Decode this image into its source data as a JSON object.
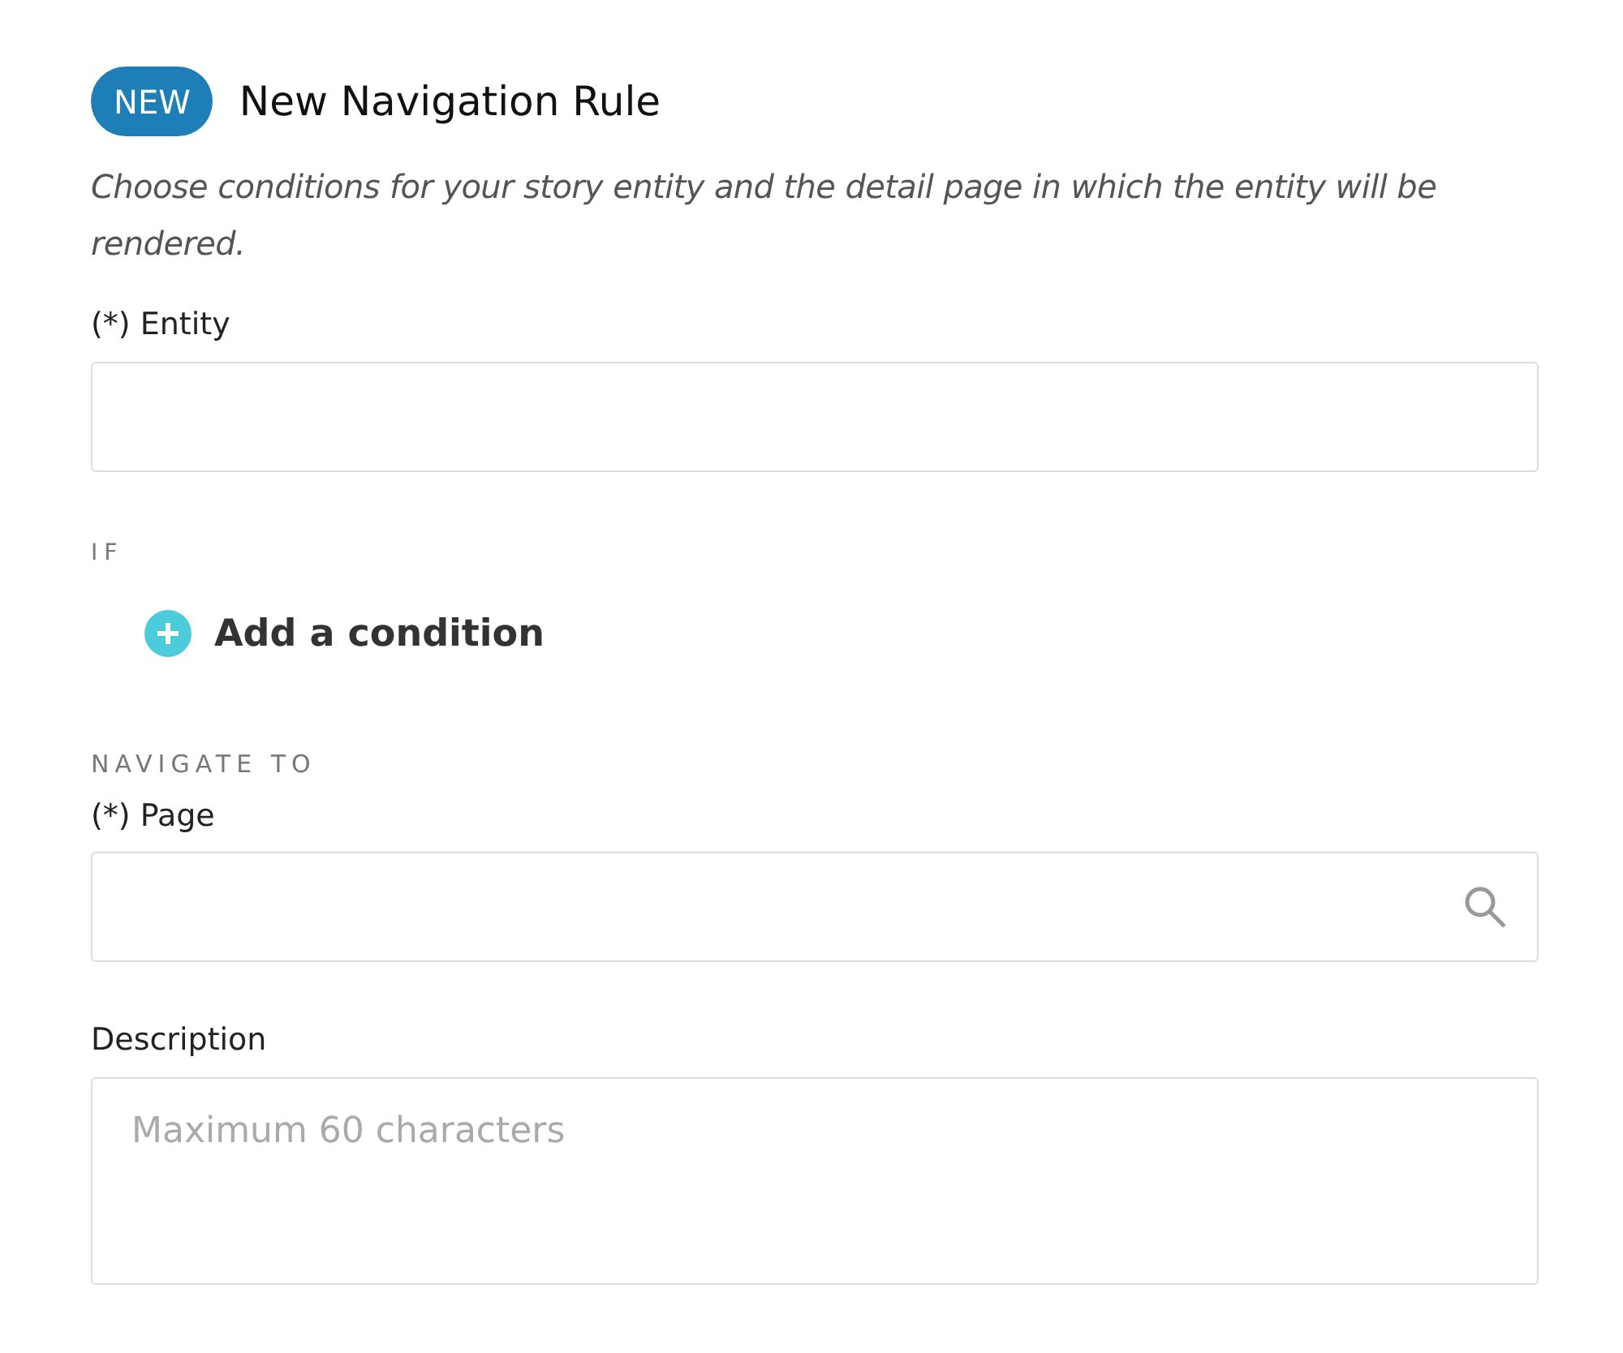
{
  "header": {
    "badge": "NEW",
    "title": "New Navigation Rule"
  },
  "intro": "Choose conditions for your story entity and the detail page in which the entity will be rendered.",
  "entity_field": {
    "label": "(*) Entity"
  },
  "if_section": {
    "heading": "IF",
    "add_button": "Add a condition"
  },
  "navigate_section": {
    "heading": "NAVIGATE TO",
    "page_field": {
      "label": "(*) Page"
    }
  },
  "description_field": {
    "label": "Description",
    "placeholder": "Maximum 60 characters"
  }
}
